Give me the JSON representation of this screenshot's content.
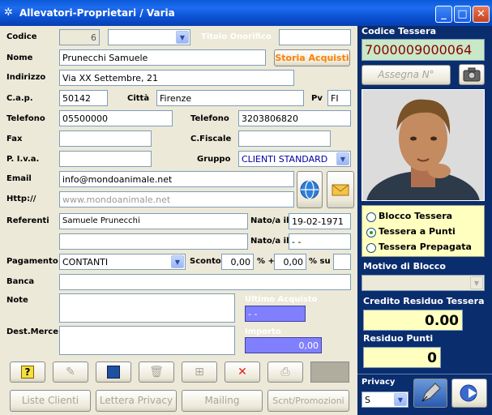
{
  "window": {
    "title": "Allevatori-Proprietari / Varia",
    "min": "_",
    "max": "□",
    "close": "✕"
  },
  "labels": {
    "codice": "Codice",
    "titolo": "Titolo Onorifico",
    "nome": "Nome",
    "indirizzo": "Indirizzo",
    "cap": "C.a.p.",
    "citta": "Città",
    "pv": "Pv",
    "telefono1": "Telefono",
    "telefono2": "Telefono",
    "fax": "Fax",
    "cfiscale": "C.Fiscale",
    "piva": "P. I.v.a.",
    "gruppo": "Gruppo",
    "email": "Email",
    "http": "Http://",
    "referenti": "Referenti",
    "natoa1": "Nato/a il",
    "natoa2": "Nato/a il",
    "pagamento": "Pagamento",
    "sconto": "Sconto",
    "percent_plus": "% +",
    "percent_su": "% su",
    "banca": "Banca",
    "note": "Note",
    "ultimo": "Ultimo Acquisto",
    "dest": "Dest.Merce",
    "importo": "Importo"
  },
  "values": {
    "codice": "6",
    "nome": "Prunecchi Samuele",
    "indirizzo": "Via XX Settembre, 21",
    "cap": "50142",
    "citta": "Firenze",
    "pv": "FI",
    "telefono1": "05500000",
    "telefono2": "3203806820",
    "gruppo": "CLIENTI STANDARD",
    "email": "info@mondoanimale.net",
    "http": "www.mondoanimale.net",
    "referente": "Samuele Prunecchi",
    "nato1": "19-02-1971",
    "nato2": "- -",
    "pagamento": "CONTANTI",
    "sconto1": "0,00",
    "sconto2": "0,00",
    "ultimo": "- -",
    "importo": "0,00"
  },
  "buttons": {
    "storia": "Storia Acquisti",
    "liste": "Liste Clienti",
    "privacy_letter": "Lettera Privacy",
    "mailing": "Mailing",
    "scnt": "Scnt/Promozioni",
    "assegna": "Assegna N°"
  },
  "right": {
    "codice_tessera_label": "Codice Tessera",
    "codice_tessera": "7000009000064",
    "radio1": "Blocco Tessera",
    "radio2": "Tessera a Punti",
    "radio3": "Tessera Prepagata",
    "motivo": "Motivo di Blocco",
    "credito_label": "Credito Residuo Tessera",
    "credito": "0.00",
    "residuo_label": "Residuo Punti",
    "residuo": "0",
    "privacy_label": "Privacy",
    "privacy_value": "S"
  },
  "colors": {
    "accent_orange": "#ff8000",
    "tessera_red": "#8b0000",
    "gruppo_blue": "#0000a0"
  }
}
